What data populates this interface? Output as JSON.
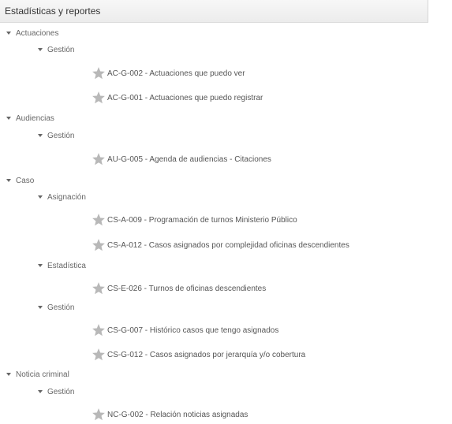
{
  "header": {
    "title": "Estadísticas y reportes"
  },
  "colors": {
    "star": "#b8b8b8",
    "header_bg": "#f1f1f1"
  },
  "icons": {
    "expanded": "caret-down-icon",
    "favorite": "star-icon"
  },
  "tree": {
    "actuaciones": {
      "label": "Actuaciones",
      "gestion": {
        "label": "Gestión",
        "items": [
          "AC-G-002 - Actuaciones que puedo ver",
          "AC-G-001 - Actuaciones que puedo registrar"
        ]
      }
    },
    "audiencias": {
      "label": "Audiencias",
      "gestion": {
        "label": "Gestión",
        "items": [
          "AU-G-005 - Agenda de audiencias - Citaciones"
        ]
      }
    },
    "caso": {
      "label": "Caso",
      "asignacion": {
        "label": "Asignación",
        "items": [
          "CS-A-009 - Programación de turnos Ministerio Público",
          "CS-A-012 - Casos asignados por complejidad oficinas descendientes"
        ]
      },
      "estadistica": {
        "label": "Estadística",
        "items": [
          "CS-E-026 - Turnos de oficinas descendientes"
        ]
      },
      "gestion": {
        "label": "Gestión",
        "items": [
          "CS-G-007 - Histórico casos que tengo asignados",
          "CS-G-012 - Casos asignados por jerarquía y/o cobertura"
        ]
      }
    },
    "noticia": {
      "label": "Noticia criminal",
      "gestion": {
        "label": "Gestión",
        "items": [
          "NC-G-002 - Relación noticias asignadas"
        ]
      }
    }
  }
}
